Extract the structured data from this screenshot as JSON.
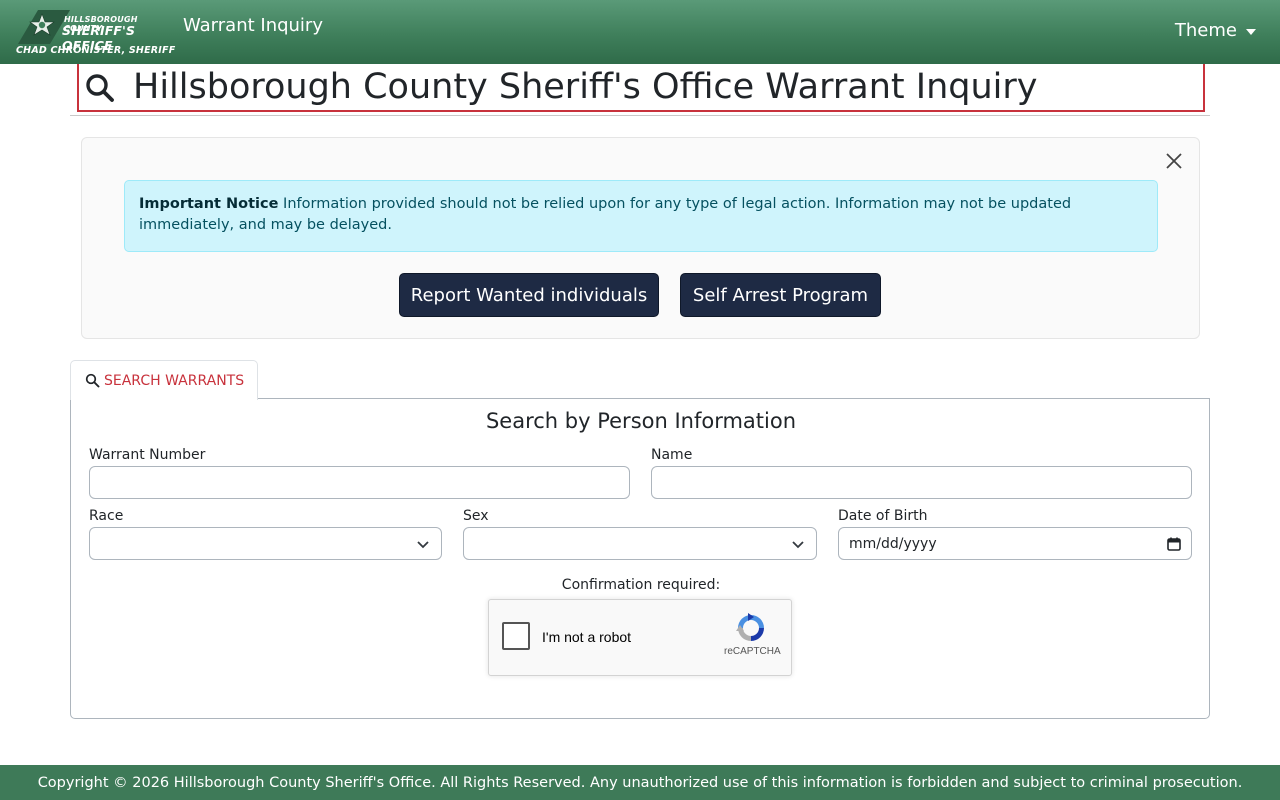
{
  "header": {
    "logo_line1": "HILLSBOROUGH COUNTY",
    "logo_line2": "SHERIFF'S OFFICE",
    "logo_line3": "CHAD CHRONISTER, SHERIFF",
    "app_title": "Warrant Inquiry",
    "theme_label": "Theme"
  },
  "page": {
    "title": "Hillsborough County Sheriff's Office Warrant Inquiry"
  },
  "notice": {
    "heading": "Important Notice",
    "body": " Information provided should not be relied upon for any type of legal action. Information may not be updated immediately, and may be delayed."
  },
  "actions": {
    "report_label": "Report Wanted individuals",
    "self_arrest_label": "Self Arrest Program"
  },
  "tabs": [
    {
      "label": "SEARCH WARRANTS",
      "active": true
    }
  ],
  "search": {
    "heading": "Search by Person Information",
    "warrant_number_label": "Warrant Number",
    "warrant_number_value": "",
    "name_label": "Name",
    "name_value": "",
    "race_label": "Race",
    "race_value": "",
    "sex_label": "Sex",
    "sex_value": "",
    "dob_label": "Date of Birth",
    "dob_placeholder": "mm/dd/yyyy",
    "confirm_label": "Confirmation required:",
    "captcha_text": "I'm not a robot",
    "captcha_brand": "reCAPTCHA"
  },
  "footer": {
    "copyright": "Copyright © 2026 Hillsborough County Sheriff's Office. All Rights Reserved. Any unauthorized use of this information is forbidden and subject to criminal prosecution."
  },
  "colors": {
    "header_green": "#3f7f5b",
    "accent_red": "#c8323c",
    "button_navy": "#1e2a44",
    "alert_bg": "#cff4fc",
    "alert_text": "#055160",
    "footer_green": "#3e7a58"
  }
}
